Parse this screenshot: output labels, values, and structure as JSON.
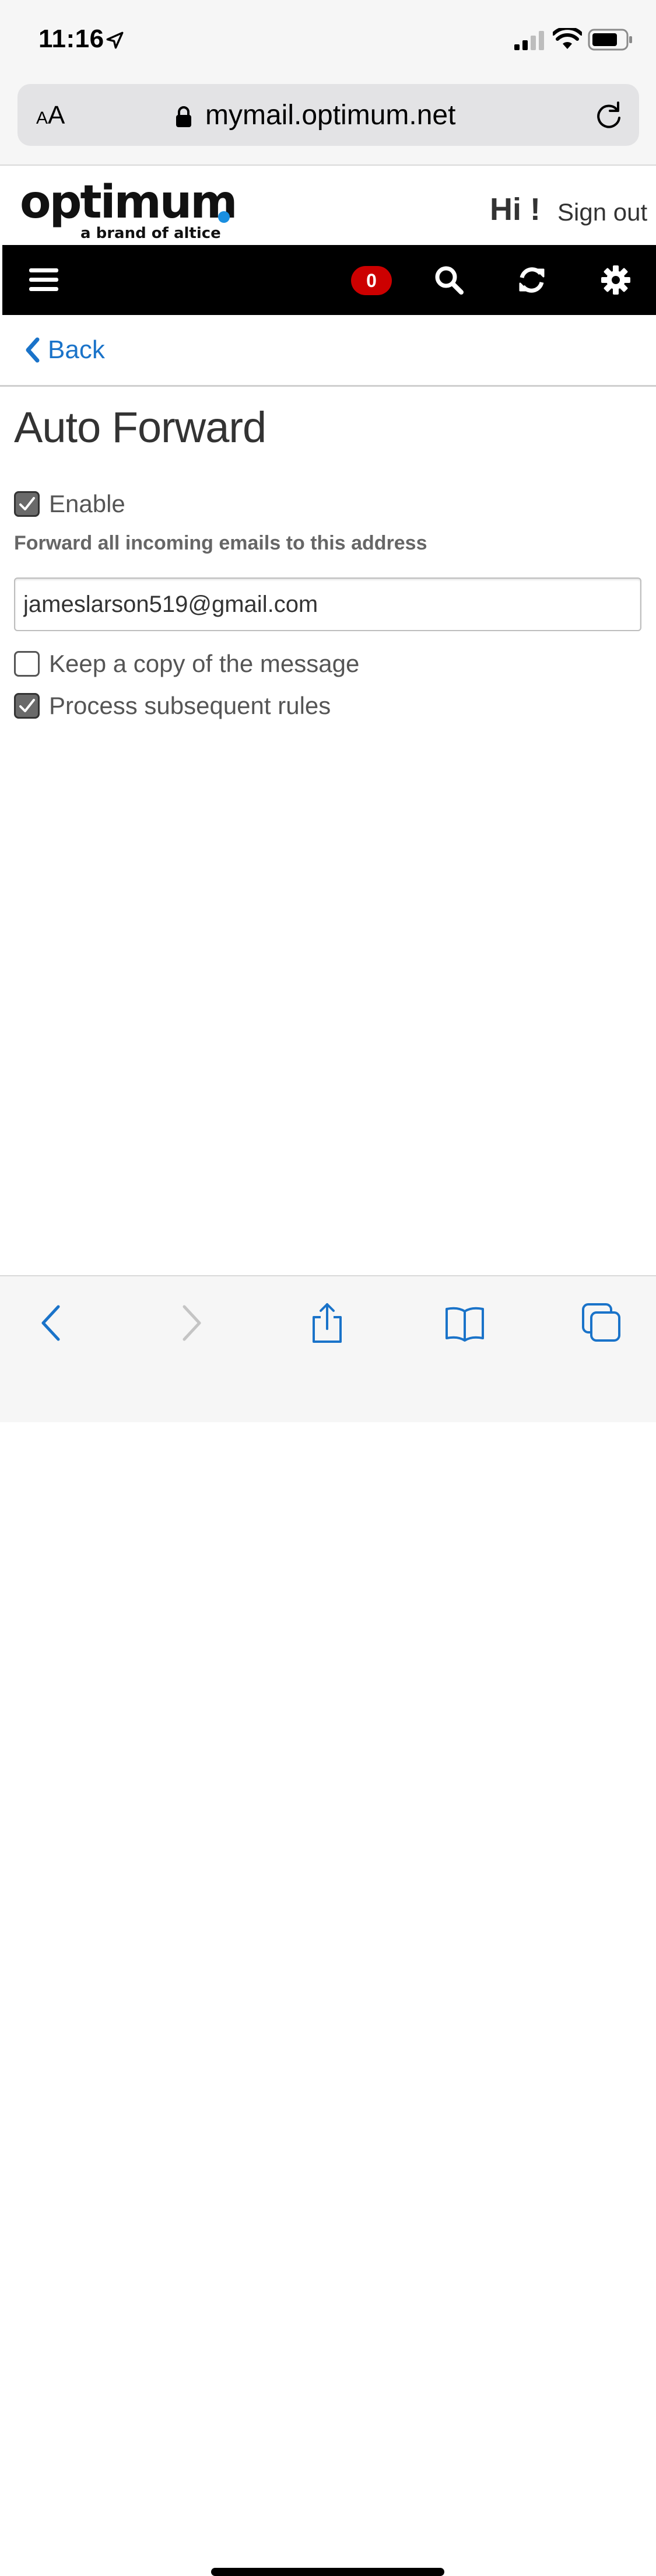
{
  "status_bar": {
    "time": "11:16",
    "icons": [
      "location-arrow-icon",
      "cellular-signal-icon",
      "wifi-icon",
      "battery-icon"
    ]
  },
  "browser": {
    "text_size_small": "A",
    "text_size_large": "A",
    "url": "mymail.optimum.net",
    "icons": [
      "lock-icon",
      "reload-icon"
    ]
  },
  "header": {
    "logo_word": "optimum",
    "logo_tagline": "a brand of altice",
    "greeting": "Hi !",
    "signout_label": "Sign out"
  },
  "toolbar": {
    "unread_count": "0",
    "icons": [
      "hamburger-menu-icon",
      "search-icon",
      "refresh-icon",
      "gear-icon"
    ]
  },
  "nav": {
    "back_label": "Back"
  },
  "form": {
    "title": "Auto Forward",
    "enable_label": "Enable",
    "enable_checked": true,
    "forward_label": "Forward all incoming emails to this address",
    "email_value": "jameslarson519@gmail.com",
    "keep_copy_label": "Keep a copy of the message",
    "keep_copy_checked": false,
    "process_rules_label": "Process subsequent rules",
    "process_rules_checked": true
  },
  "bottom_bar": {
    "icons": [
      "back-arrow-icon",
      "forward-arrow-icon",
      "share-icon",
      "bookmarks-icon",
      "tabs-icon"
    ]
  },
  "colors": {
    "link_blue": "#1a73c9",
    "badge_red": "#cc0000",
    "toolbar_black": "#000000",
    "logo_dot_blue": "#1a8fe0"
  }
}
